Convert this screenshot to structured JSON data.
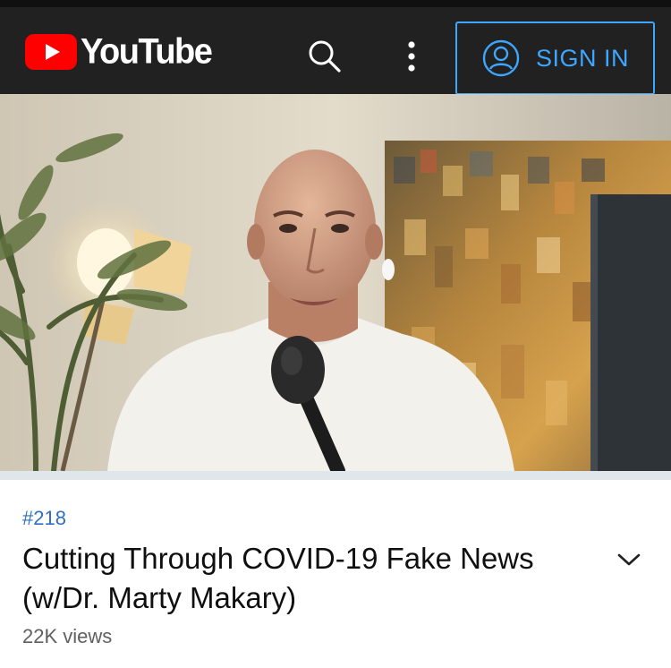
{
  "header": {
    "logo_text": "YouTube",
    "signin_label": "SIGN IN",
    "icons": [
      "youtube-logo-icon",
      "search-icon",
      "more-vert-icon",
      "account-circle-icon"
    ],
    "colors": {
      "bar_background": "#212121",
      "logo_red": "#ff0000",
      "accent_blue": "#3ea6ff"
    }
  },
  "video": {
    "hashtag": "#218",
    "title": "Cutting Through COVID-19 Fake News (w/Dr. Marty Makary)",
    "views": "22K views"
  },
  "icons": {
    "expand": "chevron-down-icon"
  }
}
